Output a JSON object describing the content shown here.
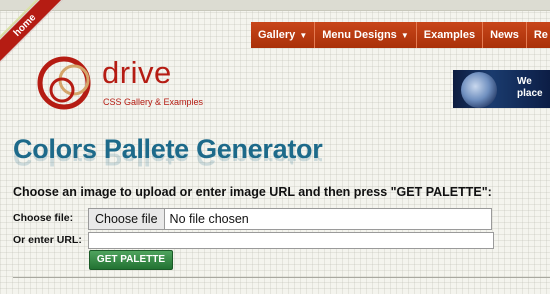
{
  "corner": {
    "home_label": "home"
  },
  "nav": {
    "items": [
      {
        "label": "Gallery",
        "has_dropdown": true
      },
      {
        "label": "Menu Designs",
        "has_dropdown": true
      },
      {
        "label": "Examples",
        "has_dropdown": false
      },
      {
        "label": "News",
        "has_dropdown": false
      },
      {
        "label": "Re",
        "has_dropdown": false
      }
    ],
    "dropdown_glyph": "▼"
  },
  "logo": {
    "name": "drive",
    "tagline": "CSS Gallery & Examples"
  },
  "banner": {
    "line1": "We",
    "line2": "place"
  },
  "page": {
    "title": "Colors Pallete Generator",
    "instructions": "Choose an image to upload or enter image URL and then press \"GET PALETTE\":"
  },
  "form": {
    "file_label": "Choose file:",
    "file_button": "Choose file",
    "file_status": "No file chosen",
    "url_label": "Or enter URL:",
    "url_value": "",
    "submit_label": "GET PALETTE"
  },
  "colors": {
    "brand_red": "#b51c13",
    "nav_orange": "#b8380f",
    "title_blue": "#1d6a8a",
    "button_green": "#2e8040"
  }
}
